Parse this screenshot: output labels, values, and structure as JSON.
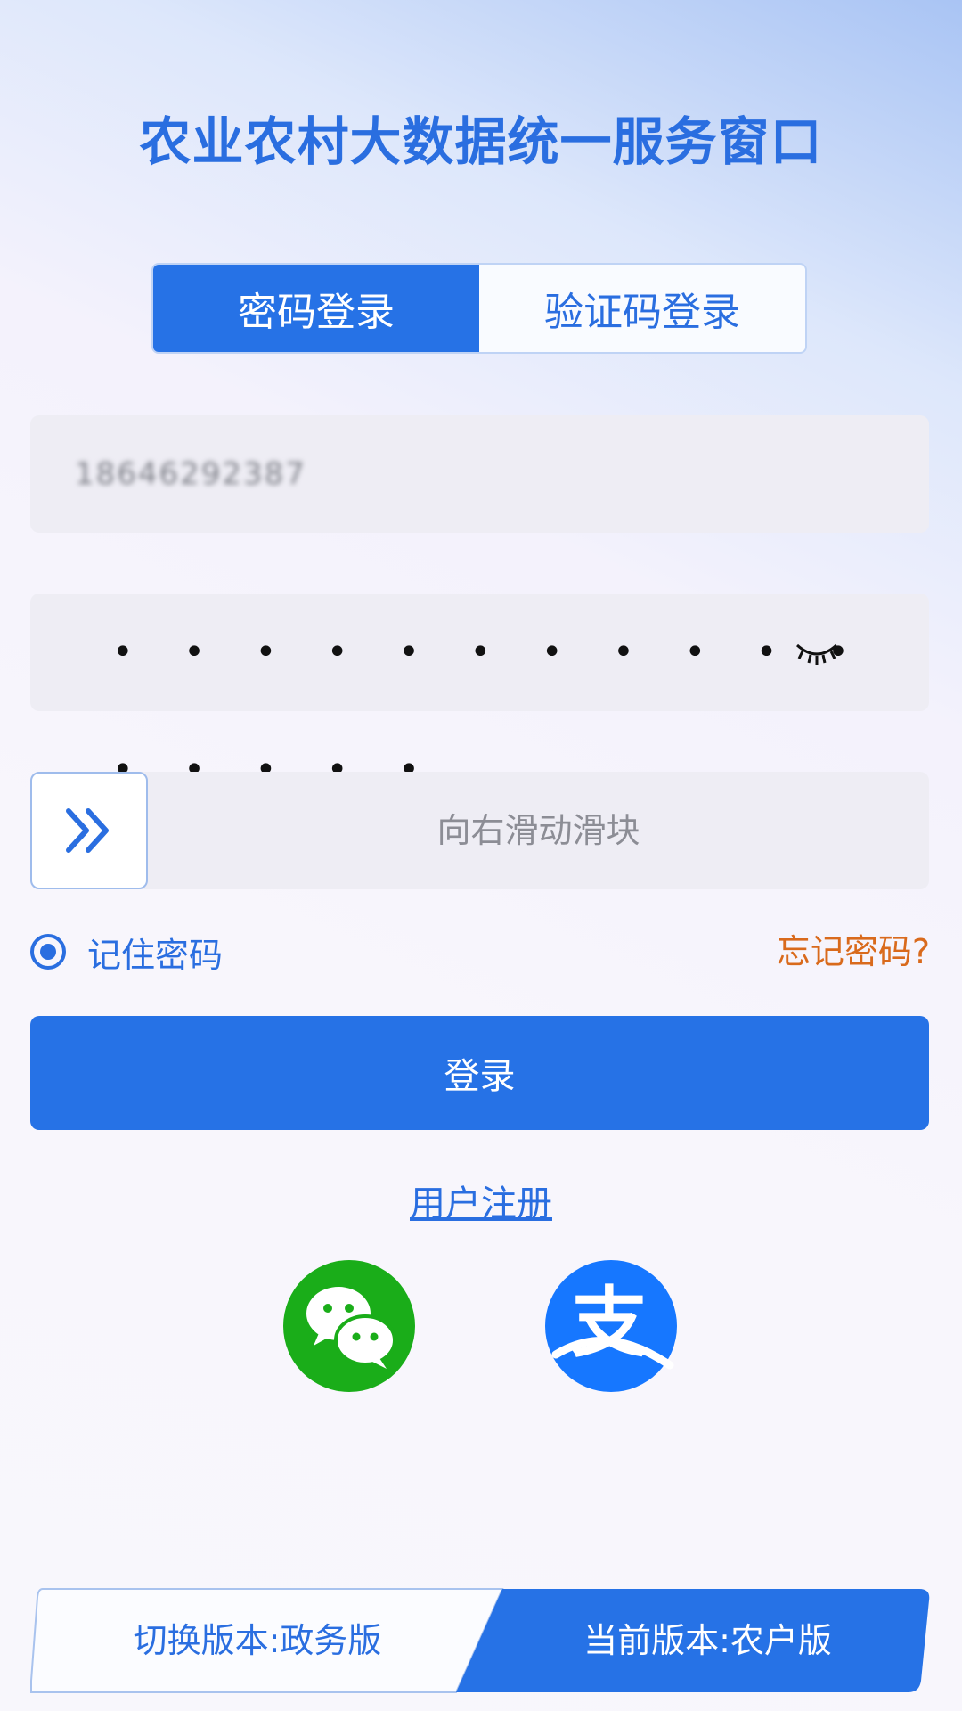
{
  "header": {
    "title": "农业农村大数据统一服务窗口"
  },
  "tabs": [
    {
      "label": "密码登录",
      "active": true
    },
    {
      "label": "验证码登录",
      "active": false
    }
  ],
  "form": {
    "phone_value": "18646292387",
    "password_mask": "• • • • • • • • • • • • • • • •",
    "slider_text": "向右滑动滑块",
    "remember_label": "记住密码",
    "remember_checked": true,
    "forgot_label": "忘记密码?",
    "login_label": "登录"
  },
  "register_label": "用户注册",
  "social": {
    "wechat_icon": "wechat-icon",
    "alipay_icon": "alipay-icon",
    "alipay_glyph": "支"
  },
  "version": {
    "switch_label": "切换版本:政务版",
    "current_label": "当前版本:农户版"
  },
  "colors": {
    "primary": "#2672e6",
    "title": "#2a6ee0",
    "forgot": "#d96a1c",
    "wechat": "#1aad19",
    "alipay": "#1677ff",
    "field_bg": "#eeedf4"
  }
}
